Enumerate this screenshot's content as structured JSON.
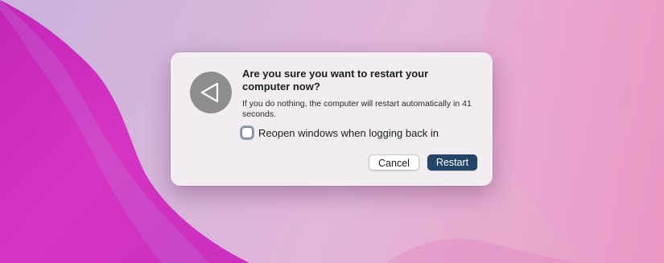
{
  "dialog": {
    "icon": "restart-triangle-icon",
    "title": "Are you sure you want to restart your computer now?",
    "message": "If you do nothing, the computer will restart automatically in 41 seconds.",
    "checkbox": {
      "label": "Reopen windows when logging back in",
      "checked": false
    },
    "buttons": {
      "cancel": "Cancel",
      "restart": "Restart"
    }
  },
  "colors": {
    "primary_button": "#24456a",
    "icon_circle": "#8e8e90",
    "wallpaper_magenta": "#d42fc0"
  }
}
